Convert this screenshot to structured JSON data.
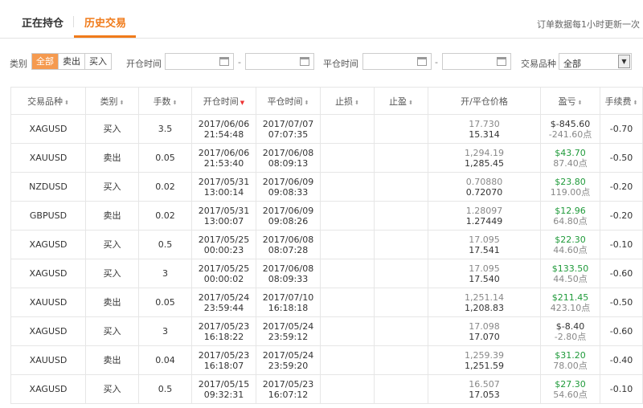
{
  "tabs": {
    "holding": "正在持仓",
    "history": "历史交易"
  },
  "notice": "订单数据每1小时更新一次",
  "filters": {
    "category_label": "类别",
    "category_options": [
      "全部",
      "卖出",
      "买入"
    ],
    "open_time_label": "开仓时间",
    "close_time_label": "平仓时间",
    "dash": "-",
    "symbol_label": "交易品种",
    "symbol_value": "全部",
    "select_arrow": "▼"
  },
  "table": {
    "headers": [
      "交易品种",
      "类别",
      "手数",
      "开仓时间",
      "平仓时间",
      "止损",
      "止盈",
      "开/平仓价格",
      "盈亏",
      "手续费"
    ],
    "sort_icon": "⬍",
    "active_sort_icon": "▼",
    "rows": [
      {
        "symbol": "XAGUSD",
        "type": "买入",
        "side": "buy",
        "lots": "3.5",
        "open_date": "2017/06/06",
        "open_time": "21:54:48",
        "close_date": "2017/07/07",
        "close_time": "07:07:35",
        "sl": "",
        "tp": "",
        "open_price": "17.730",
        "close_price": "15.314",
        "pnl": "$-845.60",
        "points": "-241.60点",
        "pnl_sign": "neg",
        "fee": "-0.70"
      },
      {
        "symbol": "XAUUSD",
        "type": "卖出",
        "side": "sell",
        "lots": "0.05",
        "open_date": "2017/06/06",
        "open_time": "21:53:40",
        "close_date": "2017/06/08",
        "close_time": "08:09:13",
        "sl": "",
        "tp": "",
        "open_price": "1,294.19",
        "close_price": "1,285.45",
        "pnl": "$43.70",
        "points": "87.40点",
        "pnl_sign": "pos",
        "fee": "-0.50"
      },
      {
        "symbol": "NZDUSD",
        "type": "买入",
        "side": "buy",
        "lots": "0.02",
        "open_date": "2017/05/31",
        "open_time": "13:00:14",
        "close_date": "2017/06/09",
        "close_time": "09:08:33",
        "sl": "",
        "tp": "",
        "open_price": "0.70880",
        "close_price": "0.72070",
        "pnl": "$23.80",
        "points": "119.00点",
        "pnl_sign": "pos",
        "fee": "-0.20"
      },
      {
        "symbol": "GBPUSD",
        "type": "卖出",
        "side": "sell",
        "lots": "0.02",
        "open_date": "2017/05/31",
        "open_time": "13:00:07",
        "close_date": "2017/06/09",
        "close_time": "09:08:26",
        "sl": "",
        "tp": "",
        "open_price": "1.28097",
        "close_price": "1.27449",
        "pnl": "$12.96",
        "points": "64.80点",
        "pnl_sign": "pos",
        "fee": "-0.20"
      },
      {
        "symbol": "XAGUSD",
        "type": "买入",
        "side": "buy",
        "lots": "0.5",
        "open_date": "2017/05/25",
        "open_time": "00:00:23",
        "close_date": "2017/06/08",
        "close_time": "08:07:28",
        "sl": "",
        "tp": "",
        "open_price": "17.095",
        "close_price": "17.541",
        "pnl": "$22.30",
        "points": "44.60点",
        "pnl_sign": "pos",
        "fee": "-0.10"
      },
      {
        "symbol": "XAGUSD",
        "type": "买入",
        "side": "buy",
        "lots": "3",
        "open_date": "2017/05/25",
        "open_time": "00:00:02",
        "close_date": "2017/06/08",
        "close_time": "08:09:33",
        "sl": "",
        "tp": "",
        "open_price": "17.095",
        "close_price": "17.540",
        "pnl": "$133.50",
        "points": "44.50点",
        "pnl_sign": "pos",
        "fee": "-0.60"
      },
      {
        "symbol": "XAUUSD",
        "type": "卖出",
        "side": "sell",
        "lots": "0.05",
        "open_date": "2017/05/24",
        "open_time": "23:59:44",
        "close_date": "2017/07/10",
        "close_time": "16:18:18",
        "sl": "",
        "tp": "",
        "open_price": "1,251.14",
        "close_price": "1,208.83",
        "pnl": "$211.45",
        "points": "423.10点",
        "pnl_sign": "pos",
        "fee": "-0.50"
      },
      {
        "symbol": "XAGUSD",
        "type": "买入",
        "side": "buy",
        "lots": "3",
        "open_date": "2017/05/23",
        "open_time": "16:18:22",
        "close_date": "2017/05/24",
        "close_time": "23:59:12",
        "sl": "",
        "tp": "",
        "open_price": "17.098",
        "close_price": "17.070",
        "pnl": "$-8.40",
        "points": "-2.80点",
        "pnl_sign": "neg",
        "fee": "-0.60"
      },
      {
        "symbol": "XAUUSD",
        "type": "卖出",
        "side": "sell",
        "lots": "0.04",
        "open_date": "2017/05/23",
        "open_time": "16:18:07",
        "close_date": "2017/05/24",
        "close_time": "23:59:20",
        "sl": "",
        "tp": "",
        "open_price": "1,259.39",
        "close_price": "1,251.59",
        "pnl": "$31.20",
        "points": "78.00点",
        "pnl_sign": "pos",
        "fee": "-0.40"
      },
      {
        "symbol": "XAGUSD",
        "type": "买入",
        "side": "buy",
        "lots": "0.5",
        "open_date": "2017/05/15",
        "open_time": "09:32:31",
        "close_date": "2017/05/23",
        "close_time": "16:07:12",
        "sl": "",
        "tp": "",
        "open_price": "16.507",
        "close_price": "17.053",
        "pnl": "$27.30",
        "points": "54.60点",
        "pnl_sign": "pos",
        "fee": "-0.10"
      }
    ]
  }
}
